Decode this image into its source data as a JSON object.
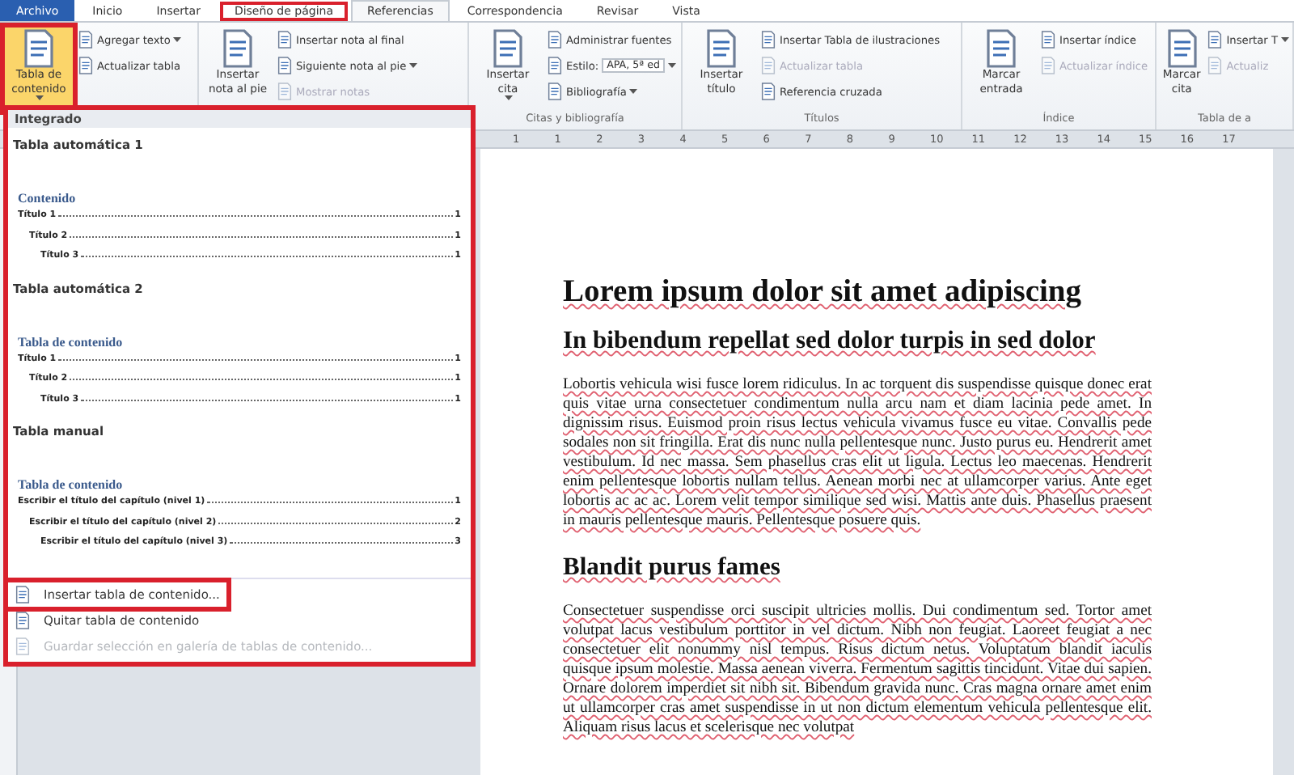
{
  "tabs": [
    {
      "label": "Archivo",
      "kind": "file",
      "selected": false,
      "highlighted": false
    },
    {
      "label": "Inicio",
      "kind": "tab",
      "selected": false,
      "highlighted": false
    },
    {
      "label": "Insertar",
      "kind": "tab",
      "selected": false,
      "highlighted": false
    },
    {
      "label": "Diseño de página",
      "kind": "tab",
      "selected": false,
      "highlighted": true
    },
    {
      "label": "Referencias",
      "kind": "tab",
      "selected": true,
      "highlighted": false
    },
    {
      "label": "Correspondencia",
      "kind": "tab",
      "selected": false,
      "highlighted": false
    },
    {
      "label": "Revisar",
      "kind": "tab",
      "selected": false,
      "highlighted": false
    },
    {
      "label": "Vista",
      "kind": "tab",
      "selected": false,
      "highlighted": false
    }
  ],
  "ribbon_groups": [
    {
      "big": {
        "lines": [
          "Tabla de",
          "contenido"
        ],
        "dropdown": true,
        "highlighted": true
      },
      "small": [
        {
          "label": "Agregar texto",
          "dropdown": true,
          "disabled": false
        },
        {
          "label": "Actualizar tabla",
          "dropdown": false,
          "disabled": false
        }
      ]
    },
    {
      "big": {
        "lines": [
          "Insertar",
          "nota al pie"
        ],
        "dropdown": false,
        "highlighted": false
      },
      "small": [
        {
          "label": "Insertar nota al final",
          "dropdown": false,
          "disabled": false
        },
        {
          "label": "Siguiente nota al pie",
          "dropdown": true,
          "disabled": false
        },
        {
          "label": "Mostrar notas",
          "dropdown": false,
          "disabled": true
        }
      ]
    },
    {
      "label": "Citas y bibliografía",
      "big": {
        "lines": [
          "Insertar",
          "cita"
        ],
        "dropdown": true,
        "highlighted": false
      },
      "small": [
        {
          "label": "Administrar fuentes",
          "dropdown": false,
          "disabled": false
        },
        {
          "label": "Estilo:",
          "kind": "select",
          "value": "APA, 5ª ed",
          "dropdown": true,
          "disabled": false
        },
        {
          "label": "Bibliografía",
          "dropdown": true,
          "disabled": false
        }
      ]
    },
    {
      "label": "Títulos",
      "big": {
        "lines": [
          "Insertar",
          "título"
        ],
        "dropdown": false,
        "highlighted": false
      },
      "small": [
        {
          "label": "Insertar Tabla de ilustraciones",
          "dropdown": false,
          "disabled": false
        },
        {
          "label": "Actualizar tabla",
          "dropdown": false,
          "disabled": true
        },
        {
          "label": "Referencia cruzada",
          "dropdown": false,
          "disabled": false
        }
      ]
    },
    {
      "label": "Índice",
      "big": {
        "lines": [
          "Marcar",
          "entrada"
        ],
        "dropdown": false,
        "highlighted": false
      },
      "small": [
        {
          "label": "Insertar índice",
          "dropdown": false,
          "disabled": false
        },
        {
          "label": "Actualizar índice",
          "dropdown": false,
          "disabled": true
        }
      ]
    },
    {
      "label": "Tabla de a",
      "big": {
        "lines": [
          "Marcar",
          "cita"
        ],
        "dropdown": false,
        "highlighted": false
      },
      "small": [
        {
          "label": "Insertar T",
          "dropdown": true,
          "disabled": false
        },
        {
          "label": "Actualiz",
          "dropdown": false,
          "disabled": true
        }
      ]
    }
  ],
  "ruler": {
    "marks": [
      "1",
      "1",
      "2",
      "3",
      "4",
      "5",
      "6",
      "7",
      "8",
      "9",
      "10",
      "11",
      "12",
      "13",
      "14",
      "15",
      "16",
      "17"
    ]
  },
  "toc_menu": {
    "highlighted": true,
    "header": "Integrado",
    "galleries": [
      {
        "title": "Tabla automática 1",
        "heading": "Contenido",
        "entries": [
          {
            "text": "Título 1",
            "page": "1",
            "children": [
              {
                "text": "Título 2",
                "page": "1",
                "children": [
                  {
                    "text": "Título 3",
                    "page": "1"
                  }
                ]
              }
            ]
          }
        ]
      },
      {
        "title": "Tabla automática 2",
        "heading": "Tabla de contenido",
        "entries": [
          {
            "text": "Título 1",
            "page": "1",
            "children": [
              {
                "text": "Título 2",
                "page": "1",
                "children": [
                  {
                    "text": "Título 3",
                    "page": "1"
                  }
                ]
              }
            ]
          }
        ]
      },
      {
        "title": "Tabla manual",
        "heading": "Tabla de contenido",
        "entries": [
          {
            "text": "Escribir el título del capítulo (nivel 1)",
            "page": "1",
            "children": [
              {
                "text": "Escribir el título del capítulo (nivel 2)",
                "page": "2",
                "children": [
                  {
                    "text": "Escribir el título del capítulo (nivel 3)",
                    "page": "3"
                  }
                ]
              }
            ]
          }
        ]
      }
    ],
    "actions": [
      {
        "label": "Insertar tabla de contenido...",
        "disabled": false,
        "highlighted": true
      },
      {
        "label": "Quitar tabla de contenido",
        "disabled": false,
        "highlighted": false
      },
      {
        "label": "Guardar selección en galería de tablas de contenido...",
        "disabled": true,
        "highlighted": false
      }
    ]
  },
  "document": [
    {
      "kind": "h1",
      "text": "Lorem ipsum dolor sit amet adipiscing"
    },
    {
      "kind": "h2",
      "text": "In bibendum repellat sed dolor turpis in sed dolor"
    },
    {
      "kind": "p",
      "text": "Lobortis vehicula wisi fusce lorem ridiculus. In ac torquent dis suspendisse quisque donec erat quis vitae urna consectetuer condimentum nulla arcu nam et diam lacinia pede amet. In dignissim risus. Euismod proin risus lectus vehicula vivamus fusce eu vitae. Convallis pede sodales non sit fringilla. Erat dis nunc nulla pellentesque nunc. Justo purus eu. Hendrerit amet vestibulum. Id nec massa. Sem phasellus cras elit ut ligula. Lectus leo maecenas. Hendrerit enim pellentesque lobortis nullam tellus. Aenean morbi nec at ullamcorper varius. Ante eget lobortis ac ac ac. Lorem velit tempor similique sed wisi. Mattis ante duis. Phasellus praesent in mauris pellentesque mauris. Pellentesque posuere quis."
    },
    {
      "kind": "h2",
      "text": "Blandit purus fames"
    },
    {
      "kind": "p",
      "text": "Consectetuer suspendisse orci suscipit ultricies mollis. Dui condimentum sed. Tortor amet volutpat lacus vestibulum porttitor in vel dictum. Nibh non feugiat. Laoreet feugiat a nec consectetuer elit nonummy nisl tempus. Risus dictum netus. Voluptatum blandit iaculis quisque ipsum molestie. Massa aenean viverra. Fermentum sagittis tincidunt. Vitae dui sapien. Ornare dolorem imperdiet sit nibh sit. Bibendum gravida nunc. Cras magna ornare amet enim ut ullamcorper cras amet suspendisse in ut non dictum elementum vehicula pellentesque elit. Aliquam risus lacus et scelerisque nec volutpat"
    }
  ]
}
